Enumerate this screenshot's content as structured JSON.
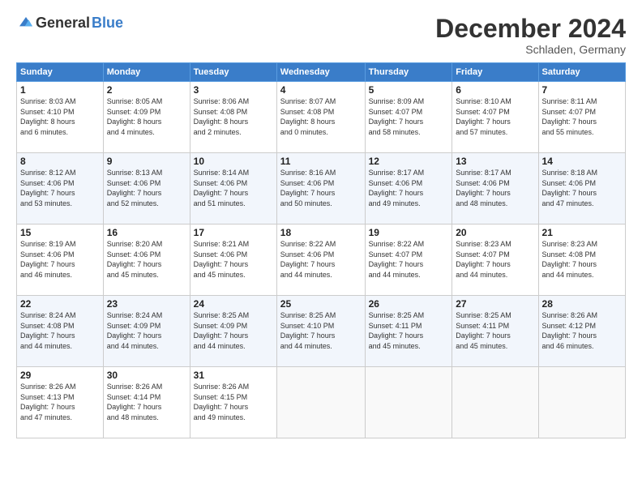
{
  "logo": {
    "general": "General",
    "blue": "Blue"
  },
  "header": {
    "month": "December 2024",
    "location": "Schladen, Germany"
  },
  "days_of_week": [
    "Sunday",
    "Monday",
    "Tuesday",
    "Wednesday",
    "Thursday",
    "Friday",
    "Saturday"
  ],
  "weeks": [
    [
      {
        "day": "1",
        "sunrise": "8:03 AM",
        "sunset": "4:10 PM",
        "daylight": "8 hours and 6 minutes."
      },
      {
        "day": "2",
        "sunrise": "8:05 AM",
        "sunset": "4:09 PM",
        "daylight": "8 hours and 4 minutes."
      },
      {
        "day": "3",
        "sunrise": "8:06 AM",
        "sunset": "4:08 PM",
        "daylight": "8 hours and 2 minutes."
      },
      {
        "day": "4",
        "sunrise": "8:07 AM",
        "sunset": "4:08 PM",
        "daylight": "8 hours and 0 minutes."
      },
      {
        "day": "5",
        "sunrise": "8:09 AM",
        "sunset": "4:07 PM",
        "daylight": "7 hours and 58 minutes."
      },
      {
        "day": "6",
        "sunrise": "8:10 AM",
        "sunset": "4:07 PM",
        "daylight": "7 hours and 57 minutes."
      },
      {
        "day": "7",
        "sunrise": "8:11 AM",
        "sunset": "4:07 PM",
        "daylight": "7 hours and 55 minutes."
      }
    ],
    [
      {
        "day": "8",
        "sunrise": "8:12 AM",
        "sunset": "4:06 PM",
        "daylight": "7 hours and 53 minutes."
      },
      {
        "day": "9",
        "sunrise": "8:13 AM",
        "sunset": "4:06 PM",
        "daylight": "7 hours and 52 minutes."
      },
      {
        "day": "10",
        "sunrise": "8:14 AM",
        "sunset": "4:06 PM",
        "daylight": "7 hours and 51 minutes."
      },
      {
        "day": "11",
        "sunrise": "8:16 AM",
        "sunset": "4:06 PM",
        "daylight": "7 hours and 50 minutes."
      },
      {
        "day": "12",
        "sunrise": "8:17 AM",
        "sunset": "4:06 PM",
        "daylight": "7 hours and 49 minutes."
      },
      {
        "day": "13",
        "sunrise": "8:17 AM",
        "sunset": "4:06 PM",
        "daylight": "7 hours and 48 minutes."
      },
      {
        "day": "14",
        "sunrise": "8:18 AM",
        "sunset": "4:06 PM",
        "daylight": "7 hours and 47 minutes."
      }
    ],
    [
      {
        "day": "15",
        "sunrise": "8:19 AM",
        "sunset": "4:06 PM",
        "daylight": "7 hours and 46 minutes."
      },
      {
        "day": "16",
        "sunrise": "8:20 AM",
        "sunset": "4:06 PM",
        "daylight": "7 hours and 45 minutes."
      },
      {
        "day": "17",
        "sunrise": "8:21 AM",
        "sunset": "4:06 PM",
        "daylight": "7 hours and 45 minutes."
      },
      {
        "day": "18",
        "sunrise": "8:22 AM",
        "sunset": "4:06 PM",
        "daylight": "7 hours and 44 minutes."
      },
      {
        "day": "19",
        "sunrise": "8:22 AM",
        "sunset": "4:07 PM",
        "daylight": "7 hours and 44 minutes."
      },
      {
        "day": "20",
        "sunrise": "8:23 AM",
        "sunset": "4:07 PM",
        "daylight": "7 hours and 44 minutes."
      },
      {
        "day": "21",
        "sunrise": "8:23 AM",
        "sunset": "4:08 PM",
        "daylight": "7 hours and 44 minutes."
      }
    ],
    [
      {
        "day": "22",
        "sunrise": "8:24 AM",
        "sunset": "4:08 PM",
        "daylight": "7 hours and 44 minutes."
      },
      {
        "day": "23",
        "sunrise": "8:24 AM",
        "sunset": "4:09 PM",
        "daylight": "7 hours and 44 minutes."
      },
      {
        "day": "24",
        "sunrise": "8:25 AM",
        "sunset": "4:09 PM",
        "daylight": "7 hours and 44 minutes."
      },
      {
        "day": "25",
        "sunrise": "8:25 AM",
        "sunset": "4:10 PM",
        "daylight": "7 hours and 44 minutes."
      },
      {
        "day": "26",
        "sunrise": "8:25 AM",
        "sunset": "4:11 PM",
        "daylight": "7 hours and 45 minutes."
      },
      {
        "day": "27",
        "sunrise": "8:25 AM",
        "sunset": "4:11 PM",
        "daylight": "7 hours and 45 minutes."
      },
      {
        "day": "28",
        "sunrise": "8:26 AM",
        "sunset": "4:12 PM",
        "daylight": "7 hours and 46 minutes."
      }
    ],
    [
      {
        "day": "29",
        "sunrise": "8:26 AM",
        "sunset": "4:13 PM",
        "daylight": "7 hours and 47 minutes."
      },
      {
        "day": "30",
        "sunrise": "8:26 AM",
        "sunset": "4:14 PM",
        "daylight": "7 hours and 48 minutes."
      },
      {
        "day": "31",
        "sunrise": "8:26 AM",
        "sunset": "4:15 PM",
        "daylight": "7 hours and 49 minutes."
      },
      null,
      null,
      null,
      null
    ]
  ]
}
